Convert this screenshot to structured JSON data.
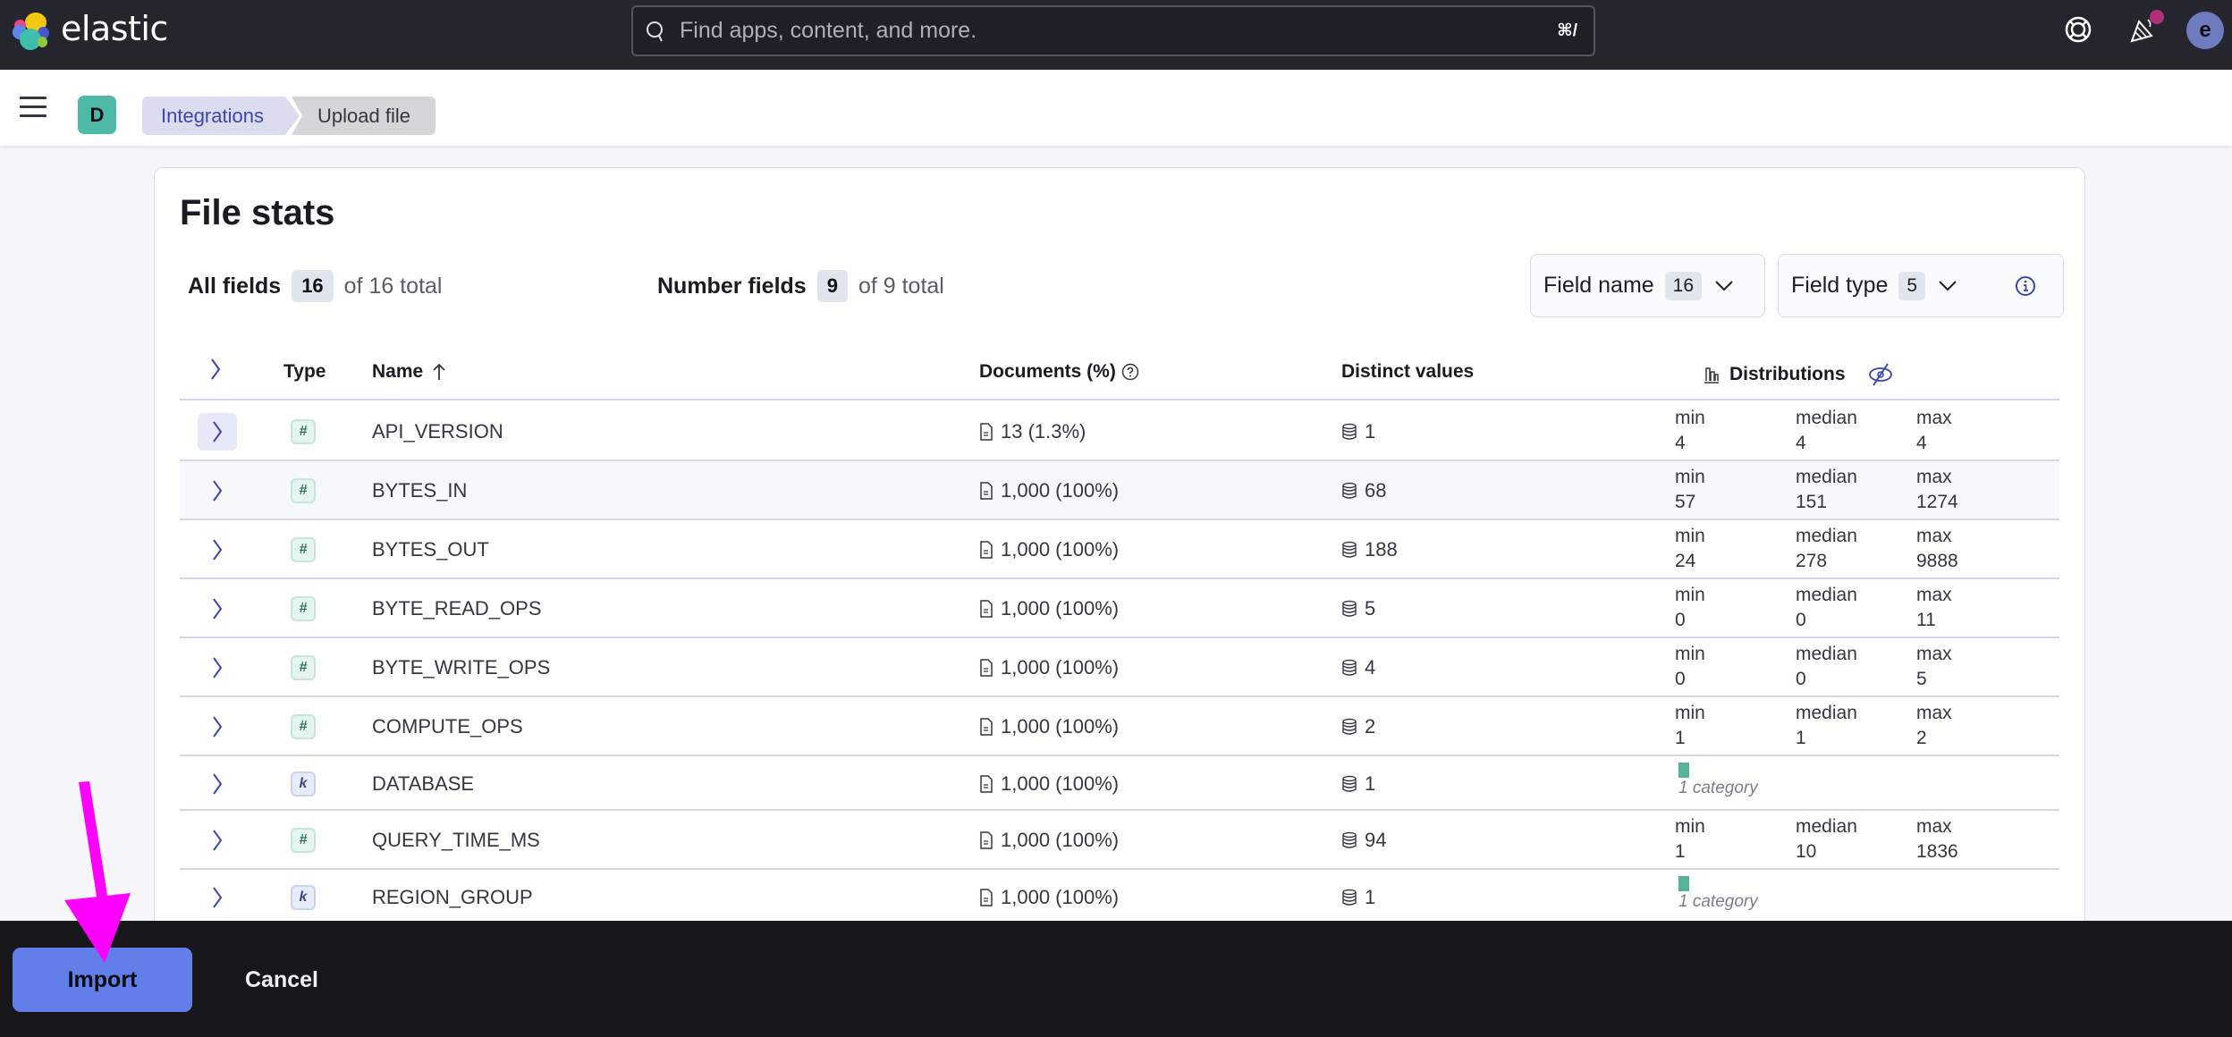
{
  "header": {
    "brand": "elastic",
    "search_placeholder": "Find apps, content, and more.",
    "search_shortcut": "⌘/",
    "icons": [
      "help-lifebuoy-icon",
      "news-feed-icon",
      "user-avatar"
    ],
    "avatar_initial": "e",
    "notification_dot_color": "#b02f79"
  },
  "nav": {
    "space_initial": "D",
    "breadcrumbs": [
      {
        "label": "Integrations",
        "current": false
      },
      {
        "label": "Upload file",
        "current": true
      }
    ]
  },
  "panel": {
    "title": "File stats",
    "all_fields": {
      "label": "All fields",
      "count": "16",
      "total": "of 16 total"
    },
    "number_fields": {
      "label": "Number fields",
      "count": "9",
      "total": "of 9 total"
    },
    "filters": {
      "field_name": {
        "label": "Field name",
        "count": "16"
      },
      "field_type": {
        "label": "Field type",
        "count": "5"
      }
    }
  },
  "table": {
    "columns": {
      "type": "Type",
      "name": "Name",
      "documents": "Documents (%)",
      "distinct": "Distinct values",
      "distributions": "Distributions"
    },
    "sort": {
      "column": "name",
      "direction": "ascending"
    },
    "rows": [
      {
        "type": "number",
        "glyph": "#",
        "name": "API_VERSION",
        "documents": "13 (1.3%)",
        "distinct": "1",
        "dist": {
          "min": "4",
          "median": "4",
          "max": "4"
        }
      },
      {
        "type": "number",
        "glyph": "#",
        "name": "BYTES_IN",
        "documents": "1,000 (100%)",
        "distinct": "68",
        "dist": {
          "min": "57",
          "median": "151",
          "max": "1274"
        }
      },
      {
        "type": "number",
        "glyph": "#",
        "name": "BYTES_OUT",
        "documents": "1,000 (100%)",
        "distinct": "188",
        "dist": {
          "min": "24",
          "median": "278",
          "max": "9888"
        }
      },
      {
        "type": "number",
        "glyph": "#",
        "name": "BYTE_READ_OPS",
        "documents": "1,000 (100%)",
        "distinct": "5",
        "dist": {
          "min": "0",
          "median": "0",
          "max": "11"
        }
      },
      {
        "type": "number",
        "glyph": "#",
        "name": "BYTE_WRITE_OPS",
        "documents": "1,000 (100%)",
        "distinct": "4",
        "dist": {
          "min": "0",
          "median": "0",
          "max": "5"
        }
      },
      {
        "type": "number",
        "glyph": "#",
        "name": "COMPUTE_OPS",
        "documents": "1,000 (100%)",
        "distinct": "2",
        "dist": {
          "min": "1",
          "median": "1",
          "max": "2"
        }
      },
      {
        "type": "keyword",
        "glyph": "k",
        "name": "DATABASE",
        "documents": "1,000 (100%)",
        "distinct": "1",
        "categories": "1 category"
      },
      {
        "type": "number",
        "glyph": "#",
        "name": "QUERY_TIME_MS",
        "documents": "1,000 (100%)",
        "distinct": "94",
        "dist": {
          "min": "1",
          "median": "10",
          "max": "1836"
        }
      },
      {
        "type": "keyword",
        "glyph": "k",
        "name": "REGION_GROUP",
        "documents": "1,000 (100%)",
        "distinct": "1",
        "categories": "1 category"
      }
    ],
    "labels": {
      "min": "min",
      "median": "median",
      "max": "max"
    }
  },
  "footer": {
    "import_label": "Import",
    "cancel_label": "Cancel"
  },
  "annotation": {
    "type": "arrow",
    "color": "#ff00ff",
    "points_to": "import-button"
  },
  "colors": {
    "header_bg": "#25252e",
    "accent": "#627ee8",
    "category_bar": "#54b399"
  }
}
